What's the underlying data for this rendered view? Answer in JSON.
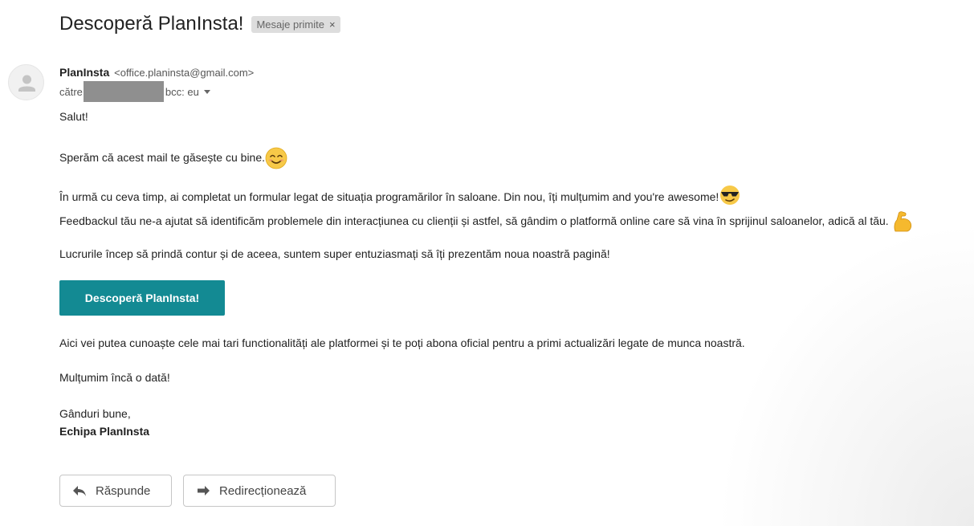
{
  "email": {
    "subject": "Descoperă PlanInsta!",
    "label": "Mesaje primite",
    "label_close": "×",
    "sender_name": "PlanInsta",
    "sender_email": "<office.planinsta@gmail.com>",
    "to_prefix": "către",
    "bcc": "bcc: eu",
    "body": {
      "greeting": "Salut!",
      "line1": "Sperăm că acest mail te găsește cu bine.",
      "line2": "În urmă cu ceva timp, ai completat un formular legat de situația programărilor în saloane. Din nou, îți mulțumim and you're awesome!",
      "line3": "Feedbackul tău ne-a ajutat să identificăm problemele din interacțiunea cu clienții și astfel, să gândim o platformă online care să vina în sprijinul saloanelor, adică al tău.",
      "line4": "Lucrurile încep să prindă contur și de aceea, suntem super entuziasmați să îți prezentăm noua noastră pagină!",
      "cta": "Descoperă PlanInsta!",
      "line5": "Aici vei putea cunoaște cele mai tari functionalități ale platformei și te poți abona oficial pentru a primi actualizări legate de munca noastră.",
      "line6": "Mulțumim încă o dată!",
      "signoff": "Gânduri bune,",
      "signature": "Echipa PlanInsta"
    }
  },
  "actions": {
    "reply": "Răspunde",
    "forward": "Redirecționează"
  },
  "icons": {
    "avatar": "person-icon",
    "emoji1": "smiling-face-icon",
    "emoji2": "sunglasses-face-icon",
    "emoji3": "flexed-biceps-icon",
    "reply": "reply-arrow-icon",
    "forward": "forward-arrow-icon"
  },
  "colors": {
    "cta_bg": "#138a93",
    "chip_bg": "#dddddd"
  }
}
